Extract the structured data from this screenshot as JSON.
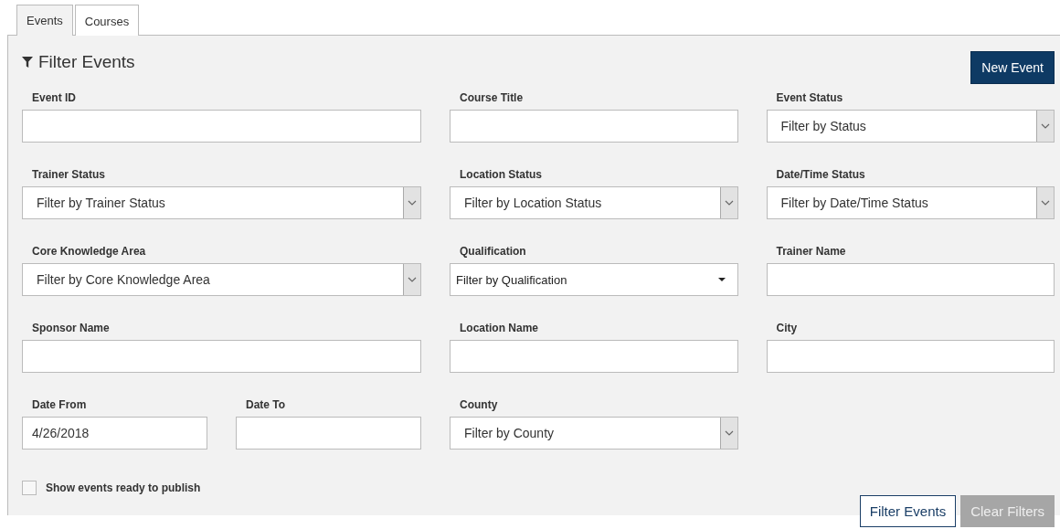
{
  "tabs": [
    {
      "label": "Events",
      "selected": true
    },
    {
      "label": "Courses",
      "selected": false
    }
  ],
  "title": "Filter Events",
  "new_button": "New Event",
  "fields": [
    {
      "label": "Event ID",
      "kind": "text"
    },
    {
      "label": "Course Title",
      "kind": "text"
    },
    {
      "label": "Event Status",
      "kind": "select",
      "placeholder": "Filter by Status"
    },
    {
      "label": "Trainer Status",
      "kind": "select",
      "placeholder": "Filter by Trainer Status"
    },
    {
      "label": "Location Status",
      "kind": "select",
      "placeholder": "Filter by Location Status"
    },
    {
      "label": "Date/Time Status",
      "kind": "select",
      "placeholder": "Filter by Date/Time Status"
    },
    {
      "label": "Core Knowledge Area",
      "kind": "select",
      "placeholder": "Filter by Core Knowledge Area"
    },
    {
      "label": "Qualification",
      "kind": "dropdown",
      "placeholder": "Filter by Qualification"
    },
    {
      "label": "Trainer Name",
      "kind": "text"
    },
    {
      "label": "Sponsor Name",
      "kind": "text"
    },
    {
      "label": "Location Name",
      "kind": "text"
    },
    {
      "label": "City",
      "kind": "text"
    },
    {
      "label": "Date From",
      "kind": "date",
      "value": "4/26/2018"
    },
    {
      "label": "Date To",
      "kind": "date"
    },
    {
      "label": "County",
      "kind": "select",
      "placeholder": "Filter by County"
    }
  ],
  "ready_to_publish": {
    "label": "Show events ready to publish",
    "checked": false
  },
  "buttons": [
    {
      "label": "Filter Events",
      "disabled": false
    },
    {
      "label": "Clear Filters",
      "disabled": true
    }
  ]
}
